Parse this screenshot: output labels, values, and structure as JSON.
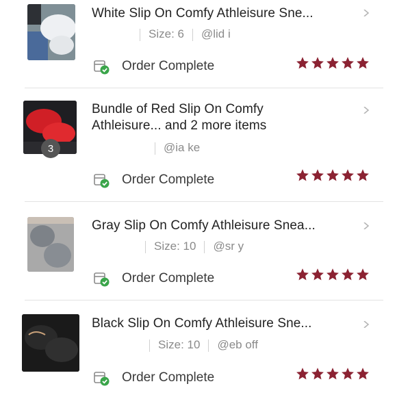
{
  "orders": [
    {
      "title": "White Slip On Comfy Athleisure Sne...",
      "size": "Size: 6",
      "user": "@lid   i",
      "status": "Order Complete",
      "rating": 5,
      "thumb_icon": "white-sneaker-photo",
      "item_count": null
    },
    {
      "title": "Bundle of Red Slip On Comfy Athleisure... and 2 more items",
      "size": "",
      "user": "@ia    ke",
      "status": "Order Complete",
      "rating": 5,
      "thumb_icon": "red-sneaker-photo",
      "item_count": "3"
    },
    {
      "title": "Gray Slip On Comfy Athleisure Snea...",
      "size": "Size: 10",
      "user": "@sr   y",
      "status": "Order Complete",
      "rating": 5,
      "thumb_icon": "gray-sneaker-photo",
      "item_count": null
    },
    {
      "title": "Black Slip On Comfy Athleisure Sne...",
      "size": "Size: 10",
      "user": "@eb   off",
      "status": "Order Complete",
      "rating": 5,
      "thumb_icon": "black-sneaker-photo",
      "item_count": null
    }
  ],
  "colors": {
    "star": "#8b2232",
    "check": "#3aa54a",
    "text": "#222222",
    "muted": "#8a8a8a"
  }
}
